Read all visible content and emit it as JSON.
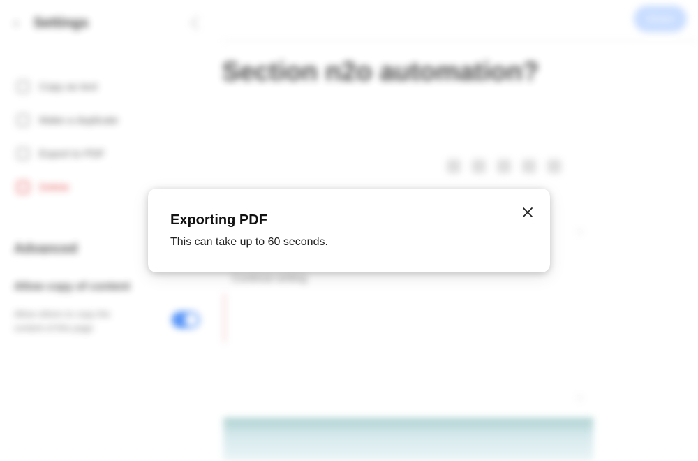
{
  "sidebar": {
    "title": "Settings",
    "items": [
      {
        "label": "Copy as text",
        "danger": false
      },
      {
        "label": "Make a duplicate",
        "danger": false
      },
      {
        "label": "Export to PDF",
        "danger": false
      },
      {
        "label": "Delete",
        "danger": true
      }
    ],
    "section_title": "Advanced",
    "setting": {
      "title": "Allow copy of content",
      "description": "Allow others to copy the content of this page"
    }
  },
  "main": {
    "share_label": "Share",
    "doc_title": "Section n2o automation?",
    "block_text": "Continue writing"
  },
  "toast": {
    "title": "Exporting PDF",
    "body": "This can take up to 60 seconds."
  },
  "icons": {
    "close": "close-icon",
    "back": "chevron-left-icon",
    "collapse": "chevron-icon"
  },
  "colors": {
    "accent": "#3b82f6",
    "danger": "#e23b3b"
  }
}
